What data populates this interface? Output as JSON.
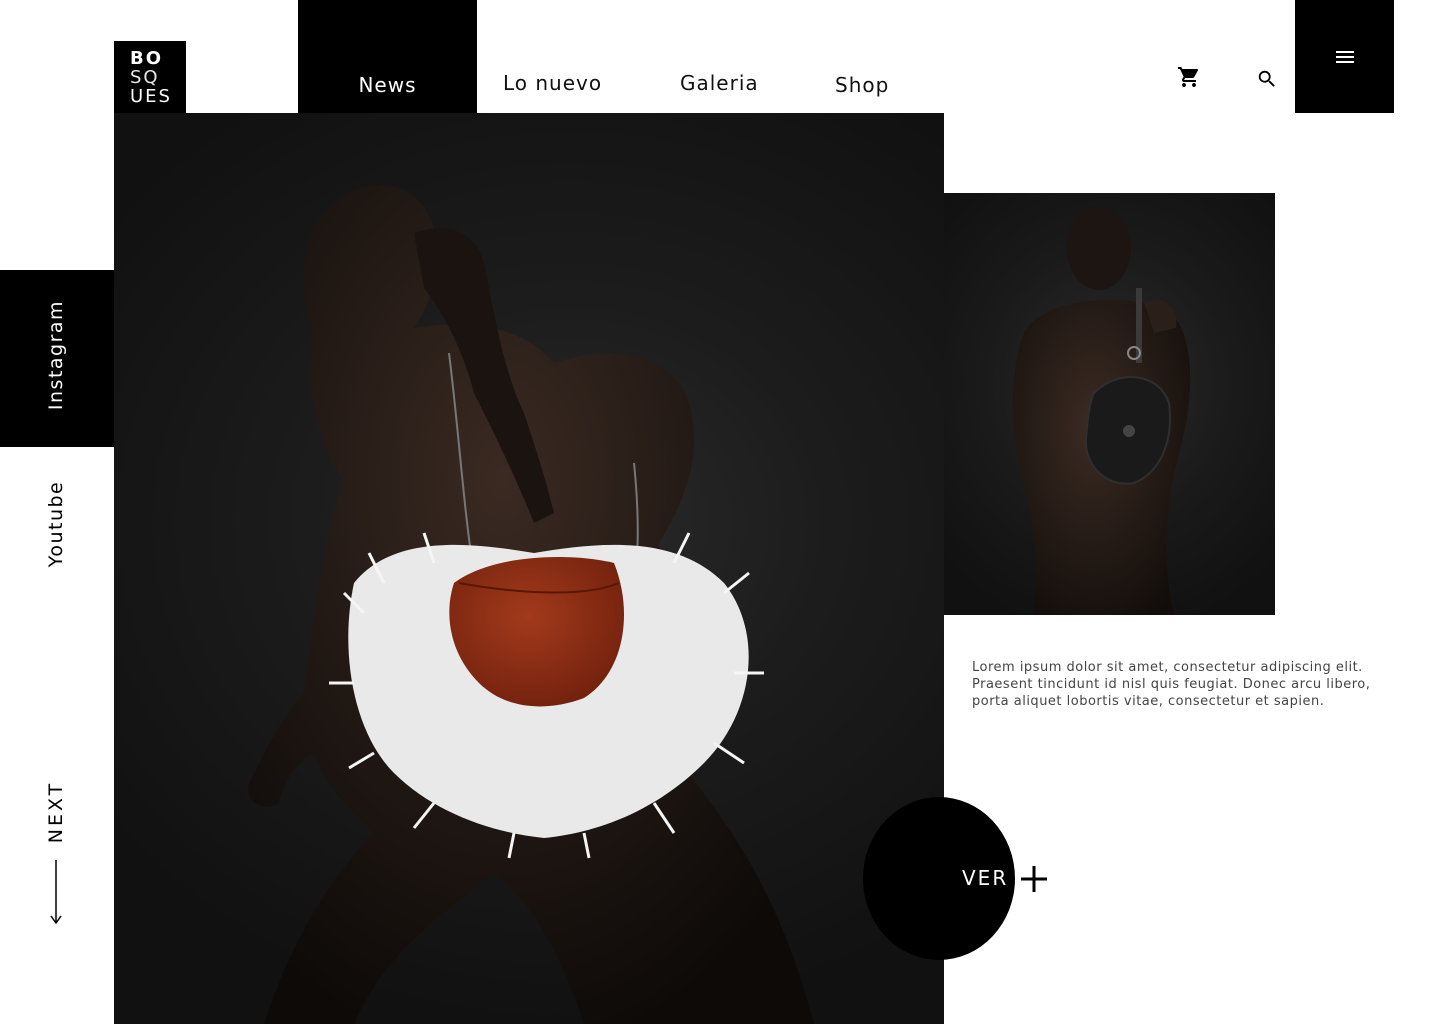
{
  "logo": {
    "line1": "BO",
    "line2": "SQ",
    "line3": "UES"
  },
  "nav": {
    "items": [
      {
        "label": "News",
        "active": true
      },
      {
        "label": "Lo nuevo",
        "active": false
      },
      {
        "label": "Galeria",
        "active": false
      },
      {
        "label": "Shop",
        "active": false
      }
    ]
  },
  "header_icons": {
    "cart": "cart-icon",
    "search": "search-icon",
    "menu": "menu-icon"
  },
  "social": {
    "instagram": "Instagram",
    "youtube": "Youtube"
  },
  "next": {
    "label": "NEXT",
    "icon": "arrow-down-icon"
  },
  "feature": {
    "description": "Lorem ipsum dolor sit amet, consectetur adipiscing elit. Praesent tincidunt id nisl quis feugiat. Donec arcu libero, porta aliquet lobortis vitae, consectetur et sapien.",
    "cta_label": "VER",
    "cta_icon": "plus-icon"
  },
  "colors": {
    "accent": "#000000",
    "background": "#ffffff",
    "bag": "#8b2a14"
  }
}
